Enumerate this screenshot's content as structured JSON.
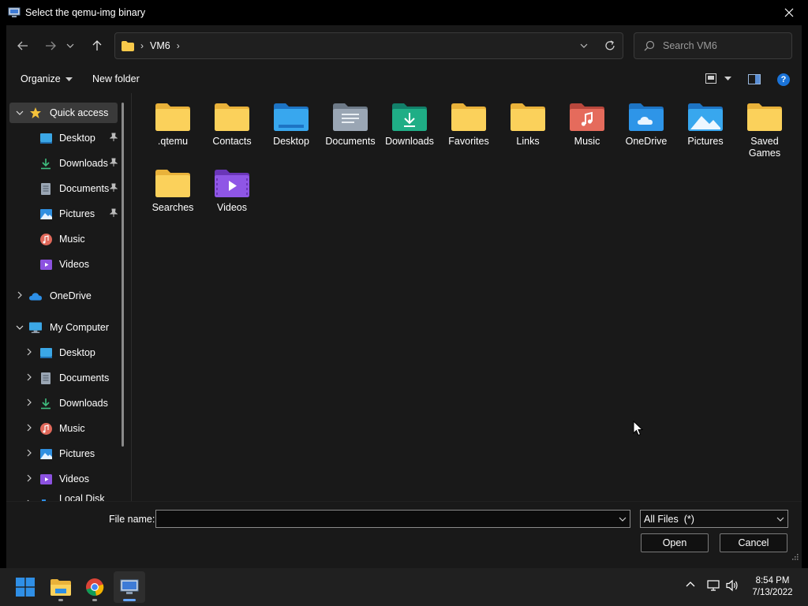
{
  "window": {
    "title": "Select the qemu-img binary"
  },
  "address": {
    "crumbs": [
      "VM6"
    ],
    "search_placeholder": "Search VM6"
  },
  "toolbar": {
    "organize_label": "Organize",
    "new_folder_label": "New folder",
    "help_glyph": "?"
  },
  "nav_pane": {
    "quick_access": {
      "label": "Quick access",
      "items": [
        {
          "label": "Desktop",
          "icon": "desktop-icon",
          "pinned": true
        },
        {
          "label": "Downloads",
          "icon": "downloads-icon",
          "pinned": true
        },
        {
          "label": "Documents",
          "icon": "documents-icon",
          "pinned": true
        },
        {
          "label": "Pictures",
          "icon": "pictures-icon",
          "pinned": true
        },
        {
          "label": "Music",
          "icon": "music-icon",
          "pinned": false
        },
        {
          "label": "Videos",
          "icon": "videos-icon",
          "pinned": false
        }
      ]
    },
    "onedrive": {
      "label": "OneDrive"
    },
    "my_computer": {
      "label": "My Computer",
      "items": [
        {
          "label": "Desktop",
          "icon": "desktop-icon"
        },
        {
          "label": "Documents",
          "icon": "documents-icon"
        },
        {
          "label": "Downloads",
          "icon": "downloads-icon"
        },
        {
          "label": "Music",
          "icon": "music-icon"
        },
        {
          "label": "Pictures",
          "icon": "pictures-icon"
        },
        {
          "label": "Videos",
          "icon": "videos-icon"
        },
        {
          "label": "Local Disk (C:)",
          "icon": "drive-icon"
        }
      ]
    }
  },
  "content": {
    "items": [
      {
        "name": ".qtemu",
        "icon": "folder-icon"
      },
      {
        "name": "Contacts",
        "icon": "folder-icon"
      },
      {
        "name": "Desktop",
        "icon": "desktop-folder-icon"
      },
      {
        "name": "Documents",
        "icon": "documents-folder-icon"
      },
      {
        "name": "Downloads",
        "icon": "downloads-folder-icon"
      },
      {
        "name": "Favorites",
        "icon": "folder-icon"
      },
      {
        "name": "Links",
        "icon": "folder-icon"
      },
      {
        "name": "Music",
        "icon": "music-folder-icon"
      },
      {
        "name": "OneDrive",
        "icon": "onedrive-folder-icon"
      },
      {
        "name": "Pictures",
        "icon": "pictures-folder-icon"
      },
      {
        "name": "Saved Games",
        "icon": "folder-icon"
      },
      {
        "name": "Searches",
        "icon": "folder-icon"
      },
      {
        "name": "Videos",
        "icon": "videos-folder-icon"
      }
    ]
  },
  "bottom": {
    "file_name_label": "File name:",
    "file_name_value": "",
    "file_type_value": "All Files  (*)",
    "open_label": "Open",
    "cancel_label": "Cancel"
  },
  "taskbar": {
    "apps": [
      "start-icon",
      "file-explorer-icon",
      "chrome-icon",
      "qtemu-icon"
    ],
    "time": "8:54 PM",
    "date": "7/13/2022"
  },
  "colors": {
    "folder_yellow": "#f8c94a",
    "accent_blue": "#1a73d8",
    "dialog_bg": "#191919"
  }
}
